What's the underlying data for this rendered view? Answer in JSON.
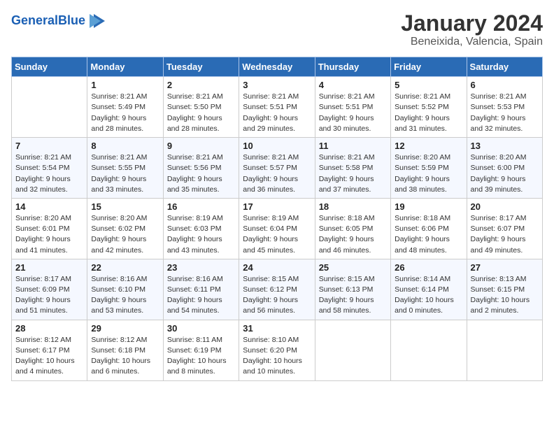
{
  "header": {
    "logo_line1": "General",
    "logo_line2": "Blue",
    "title": "January 2024",
    "subtitle": "Beneixida, Valencia, Spain"
  },
  "weekdays": [
    "Sunday",
    "Monday",
    "Tuesday",
    "Wednesday",
    "Thursday",
    "Friday",
    "Saturday"
  ],
  "weeks": [
    [
      {
        "day": "",
        "info": ""
      },
      {
        "day": "1",
        "info": "Sunrise: 8:21 AM\nSunset: 5:49 PM\nDaylight: 9 hours\nand 28 minutes."
      },
      {
        "day": "2",
        "info": "Sunrise: 8:21 AM\nSunset: 5:50 PM\nDaylight: 9 hours\nand 28 minutes."
      },
      {
        "day": "3",
        "info": "Sunrise: 8:21 AM\nSunset: 5:51 PM\nDaylight: 9 hours\nand 29 minutes."
      },
      {
        "day": "4",
        "info": "Sunrise: 8:21 AM\nSunset: 5:51 PM\nDaylight: 9 hours\nand 30 minutes."
      },
      {
        "day": "5",
        "info": "Sunrise: 8:21 AM\nSunset: 5:52 PM\nDaylight: 9 hours\nand 31 minutes."
      },
      {
        "day": "6",
        "info": "Sunrise: 8:21 AM\nSunset: 5:53 PM\nDaylight: 9 hours\nand 32 minutes."
      }
    ],
    [
      {
        "day": "7",
        "info": "Sunrise: 8:21 AM\nSunset: 5:54 PM\nDaylight: 9 hours\nand 32 minutes."
      },
      {
        "day": "8",
        "info": "Sunrise: 8:21 AM\nSunset: 5:55 PM\nDaylight: 9 hours\nand 33 minutes."
      },
      {
        "day": "9",
        "info": "Sunrise: 8:21 AM\nSunset: 5:56 PM\nDaylight: 9 hours\nand 35 minutes."
      },
      {
        "day": "10",
        "info": "Sunrise: 8:21 AM\nSunset: 5:57 PM\nDaylight: 9 hours\nand 36 minutes."
      },
      {
        "day": "11",
        "info": "Sunrise: 8:21 AM\nSunset: 5:58 PM\nDaylight: 9 hours\nand 37 minutes."
      },
      {
        "day": "12",
        "info": "Sunrise: 8:20 AM\nSunset: 5:59 PM\nDaylight: 9 hours\nand 38 minutes."
      },
      {
        "day": "13",
        "info": "Sunrise: 8:20 AM\nSunset: 6:00 PM\nDaylight: 9 hours\nand 39 minutes."
      }
    ],
    [
      {
        "day": "14",
        "info": "Sunrise: 8:20 AM\nSunset: 6:01 PM\nDaylight: 9 hours\nand 41 minutes."
      },
      {
        "day": "15",
        "info": "Sunrise: 8:20 AM\nSunset: 6:02 PM\nDaylight: 9 hours\nand 42 minutes."
      },
      {
        "day": "16",
        "info": "Sunrise: 8:19 AM\nSunset: 6:03 PM\nDaylight: 9 hours\nand 43 minutes."
      },
      {
        "day": "17",
        "info": "Sunrise: 8:19 AM\nSunset: 6:04 PM\nDaylight: 9 hours\nand 45 minutes."
      },
      {
        "day": "18",
        "info": "Sunrise: 8:18 AM\nSunset: 6:05 PM\nDaylight: 9 hours\nand 46 minutes."
      },
      {
        "day": "19",
        "info": "Sunrise: 8:18 AM\nSunset: 6:06 PM\nDaylight: 9 hours\nand 48 minutes."
      },
      {
        "day": "20",
        "info": "Sunrise: 8:17 AM\nSunset: 6:07 PM\nDaylight: 9 hours\nand 49 minutes."
      }
    ],
    [
      {
        "day": "21",
        "info": "Sunrise: 8:17 AM\nSunset: 6:09 PM\nDaylight: 9 hours\nand 51 minutes."
      },
      {
        "day": "22",
        "info": "Sunrise: 8:16 AM\nSunset: 6:10 PM\nDaylight: 9 hours\nand 53 minutes."
      },
      {
        "day": "23",
        "info": "Sunrise: 8:16 AM\nSunset: 6:11 PM\nDaylight: 9 hours\nand 54 minutes."
      },
      {
        "day": "24",
        "info": "Sunrise: 8:15 AM\nSunset: 6:12 PM\nDaylight: 9 hours\nand 56 minutes."
      },
      {
        "day": "25",
        "info": "Sunrise: 8:15 AM\nSunset: 6:13 PM\nDaylight: 9 hours\nand 58 minutes."
      },
      {
        "day": "26",
        "info": "Sunrise: 8:14 AM\nSunset: 6:14 PM\nDaylight: 10 hours\nand 0 minutes."
      },
      {
        "day": "27",
        "info": "Sunrise: 8:13 AM\nSunset: 6:15 PM\nDaylight: 10 hours\nand 2 minutes."
      }
    ],
    [
      {
        "day": "28",
        "info": "Sunrise: 8:12 AM\nSunset: 6:17 PM\nDaylight: 10 hours\nand 4 minutes."
      },
      {
        "day": "29",
        "info": "Sunrise: 8:12 AM\nSunset: 6:18 PM\nDaylight: 10 hours\nand 6 minutes."
      },
      {
        "day": "30",
        "info": "Sunrise: 8:11 AM\nSunset: 6:19 PM\nDaylight: 10 hours\nand 8 minutes."
      },
      {
        "day": "31",
        "info": "Sunrise: 8:10 AM\nSunset: 6:20 PM\nDaylight: 10 hours\nand 10 minutes."
      },
      {
        "day": "",
        "info": ""
      },
      {
        "day": "",
        "info": ""
      },
      {
        "day": "",
        "info": ""
      }
    ]
  ]
}
